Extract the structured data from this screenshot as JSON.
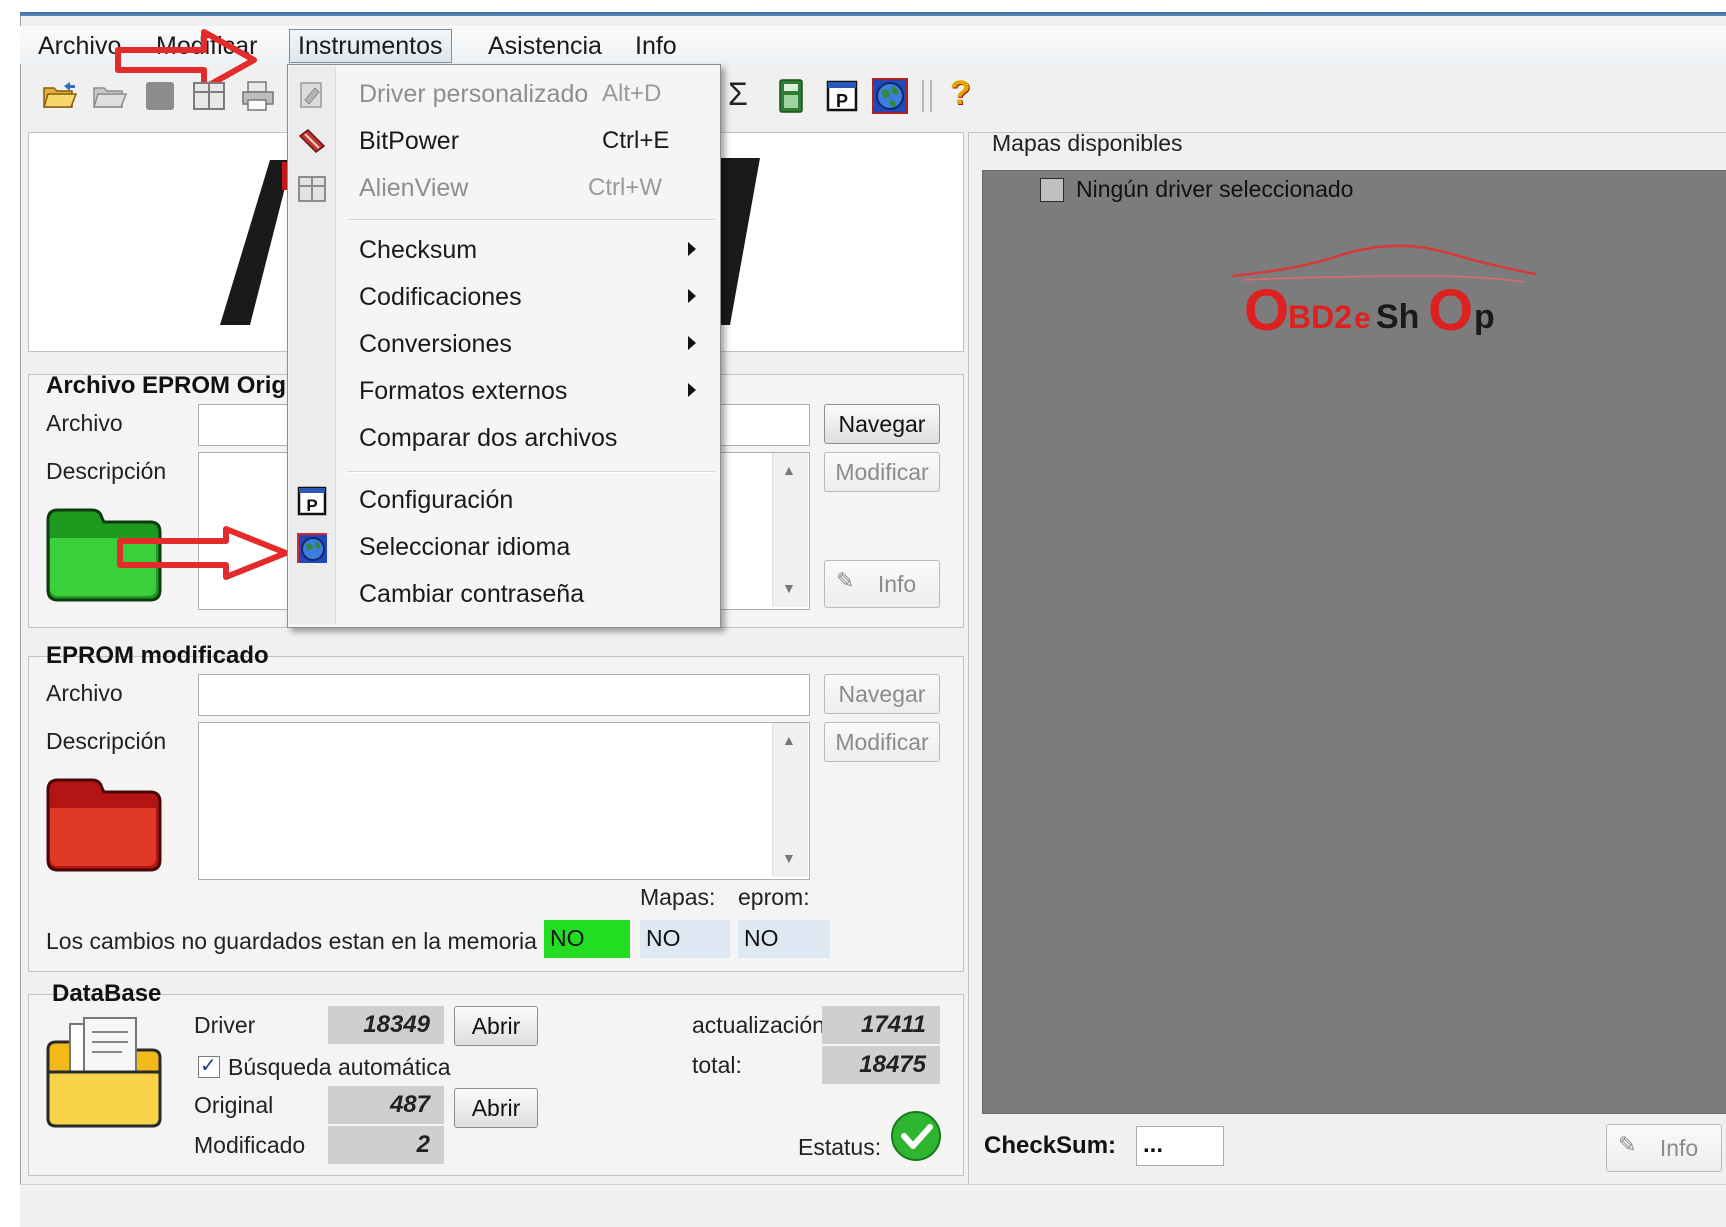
{
  "menubar": {
    "items": [
      "Archivo",
      "Modificar",
      "Instrumentos",
      "Asistencia",
      "Info"
    ]
  },
  "toolbar": {
    "icons": [
      "open-folder-icon",
      "open-folder-disabled-icon",
      "save-icon",
      "alienview-icon",
      "print-icon",
      "sum-icon",
      "calculator-icon",
      "configuration-icon",
      "globe-icon",
      "help-icon"
    ]
  },
  "instrumentos_menu": {
    "items": [
      {
        "label": "Driver personalizado",
        "shortcut": "Alt+D",
        "enabled": false,
        "icon": "driver-icon"
      },
      {
        "label": "BitPower",
        "shortcut": "Ctrl+E",
        "enabled": true,
        "icon": "bitpower-icon"
      },
      {
        "label": "AlienView",
        "shortcut": "Ctrl+W",
        "enabled": false,
        "icon": "alienview-icon"
      },
      {
        "label": "Checksum",
        "submenu": true
      },
      {
        "label": "Codificaciones",
        "submenu": true
      },
      {
        "label": "Conversiones",
        "submenu": true
      },
      {
        "label": "Formatos externos",
        "submenu": true
      },
      {
        "label": "Comparar dos archivos"
      },
      {
        "label": "Configuración",
        "icon": "configuration-icon"
      },
      {
        "label": "Seleccionar idioma",
        "icon": "globe-icon"
      },
      {
        "label": "Cambiar contraseña"
      }
    ]
  },
  "eprom_original": {
    "title": "Archivo EPROM Orig",
    "archivo_label": "Archivo",
    "descripcion_label": "Descripción",
    "archivo_value": "",
    "navegar": "Navegar",
    "modificar": "Modificar",
    "info": "Info"
  },
  "eprom_modificado": {
    "title": "EPROM  modificado",
    "archivo_label": "Archivo",
    "descripcion_label": "Descripción",
    "archivo_value": "",
    "navegar": "Navegar",
    "modificar": "Modificar"
  },
  "unsaved": {
    "label": "Los cambios no guardados estan en la memoria",
    "mapas_label": "Mapas:",
    "eprom_label": "eprom:",
    "values": [
      "NO",
      "NO",
      "NO"
    ],
    "colors": [
      "#22dd22",
      "#dde8f3",
      "#dde8f3"
    ]
  },
  "database": {
    "title": "DataBase",
    "driver_label": "Driver",
    "driver_value": "18349",
    "abrir": "Abrir",
    "busqueda_label": "Búsqueda automática",
    "busqueda_checked": true,
    "original_label": "Original",
    "original_value": "487",
    "modificado_label": "Modificado",
    "modificado_value": "2",
    "actualizacion_label": "actualización:",
    "actualizacion_value": "17411",
    "total_label": "total:",
    "total_value": "18475",
    "estatus_label": "Estatus:"
  },
  "maps": {
    "title": "Mapas disponibles",
    "tree_item": "Ningún driver seleccionado",
    "watermark": "OBD2eShOp"
  },
  "checksum": {
    "label": "CheckSum:",
    "value": "...",
    "info": "Info"
  }
}
